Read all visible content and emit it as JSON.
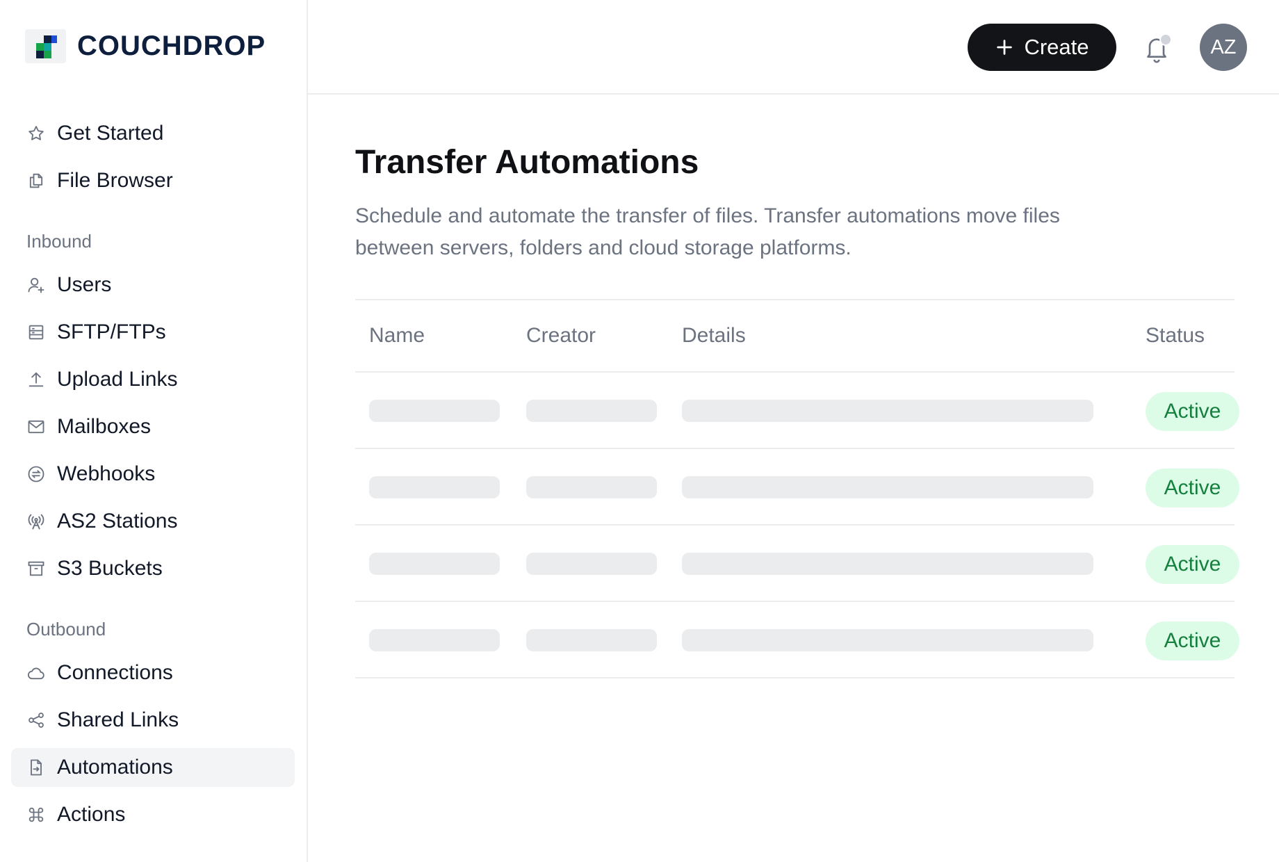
{
  "brand": {
    "name": "COUCHDROP",
    "colors": {
      "navy": "#0d1f3d",
      "green": "#16a34a",
      "teal": "#0ea5a4",
      "blue": "#1d4ed8"
    }
  },
  "sidebar": {
    "top_items": [
      {
        "label": "Get Started",
        "icon": "star-icon"
      },
      {
        "label": "File Browser",
        "icon": "files-icon"
      }
    ],
    "inbound": {
      "title": "Inbound",
      "items": [
        {
          "label": "Users",
          "icon": "user-plus-icon"
        },
        {
          "label": "SFTP/FTPs",
          "icon": "server-icon"
        },
        {
          "label": "Upload Links",
          "icon": "upload-icon"
        },
        {
          "label": "Mailboxes",
          "icon": "mail-icon"
        },
        {
          "label": "Webhooks",
          "icon": "webhook-icon"
        },
        {
          "label": "AS2 Stations",
          "icon": "antenna-icon"
        },
        {
          "label": "S3 Buckets",
          "icon": "archive-icon"
        }
      ]
    },
    "outbound": {
      "title": "Outbound",
      "items": [
        {
          "label": "Connections",
          "icon": "cloud-icon"
        },
        {
          "label": "Shared Links",
          "icon": "share-icon"
        },
        {
          "label": "Automations",
          "icon": "file-arrow-icon",
          "active": true
        },
        {
          "label": "Actions",
          "icon": "command-icon"
        }
      ]
    }
  },
  "header": {
    "create_label": "Create",
    "avatar_initials": "AZ"
  },
  "main": {
    "title": "Transfer Automations",
    "description": "Schedule and automate the transfer of files. Transfer automations move files between servers, folders and cloud storage platforms.",
    "table": {
      "columns": [
        "Name",
        "Creator",
        "Details",
        "Status"
      ],
      "rows": [
        {
          "status": "Active"
        },
        {
          "status": "Active"
        },
        {
          "status": "Active"
        },
        {
          "status": "Active"
        }
      ]
    }
  }
}
